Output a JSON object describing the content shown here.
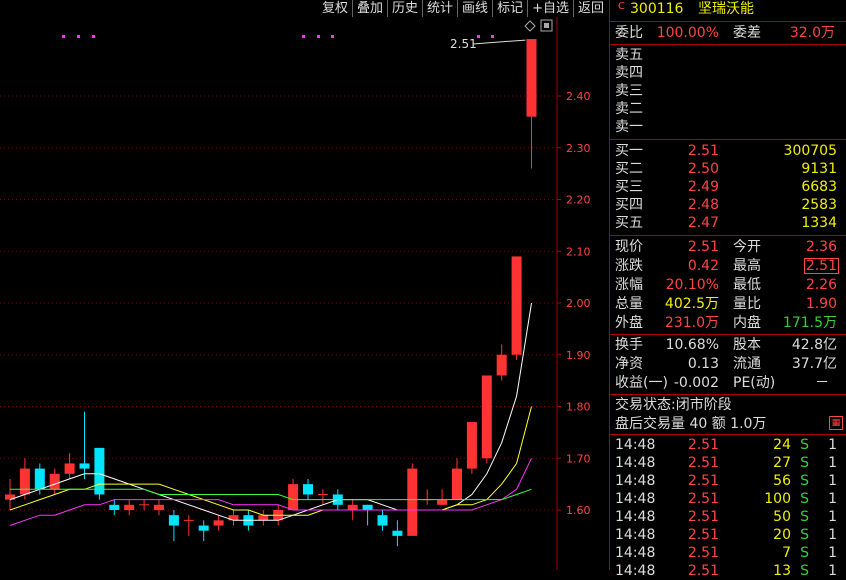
{
  "toolbar": {
    "items": [
      "复权",
      "叠加",
      "历史",
      "统计",
      "画线",
      "标记",
      "+自选",
      "返回"
    ]
  },
  "chart": {
    "y_ticks": [
      "2.40",
      "2.30",
      "2.20",
      "2.10",
      "2.00",
      "1.90",
      "1.80",
      "1.70",
      "1.60"
    ],
    "last_price_label": "2.51",
    "up_color": "#ff3333",
    "down_color": "#00e5ff",
    "ma_colors": [
      "#ffffff",
      "#ffff33",
      "#ff33ff",
      "#33ff33"
    ]
  },
  "chart_data": {
    "type": "candlestick",
    "ylim": [
      1.53,
      2.56
    ],
    "candles": [
      {
        "o": 1.62,
        "c": 1.63,
        "h": 1.66,
        "l": 1.6
      },
      {
        "o": 1.63,
        "c": 1.68,
        "h": 1.7,
        "l": 1.62
      },
      {
        "o": 1.68,
        "c": 1.64,
        "h": 1.69,
        "l": 1.63
      },
      {
        "o": 1.64,
        "c": 1.67,
        "h": 1.68,
        "l": 1.63
      },
      {
        "o": 1.67,
        "c": 1.69,
        "h": 1.71,
        "l": 1.66
      },
      {
        "o": 1.69,
        "c": 1.68,
        "h": 1.79,
        "l": 1.66
      },
      {
        "o": 1.72,
        "c": 1.63,
        "h": 1.72,
        "l": 1.62
      },
      {
        "o": 1.61,
        "c": 1.6,
        "h": 1.62,
        "l": 1.59
      },
      {
        "o": 1.6,
        "c": 1.61,
        "h": 1.62,
        "l": 1.59
      },
      {
        "o": 1.61,
        "c": 1.61,
        "h": 1.62,
        "l": 1.6
      },
      {
        "o": 1.6,
        "c": 1.61,
        "h": 1.62,
        "l": 1.59
      },
      {
        "o": 1.59,
        "c": 1.57,
        "h": 1.6,
        "l": 1.54
      },
      {
        "o": 1.58,
        "c": 1.58,
        "h": 1.59,
        "l": 1.55
      },
      {
        "o": 1.57,
        "c": 1.56,
        "h": 1.58,
        "l": 1.54
      },
      {
        "o": 1.57,
        "c": 1.58,
        "h": 1.59,
        "l": 1.56
      },
      {
        "o": 1.58,
        "c": 1.59,
        "h": 1.6,
        "l": 1.57
      },
      {
        "o": 1.59,
        "c": 1.57,
        "h": 1.6,
        "l": 1.56
      },
      {
        "o": 1.58,
        "c": 1.59,
        "h": 1.6,
        "l": 1.57
      },
      {
        "o": 1.58,
        "c": 1.6,
        "h": 1.61,
        "l": 1.57
      },
      {
        "o": 1.6,
        "c": 1.65,
        "h": 1.66,
        "l": 1.6
      },
      {
        "o": 1.65,
        "c": 1.63,
        "h": 1.66,
        "l": 1.62
      },
      {
        "o": 1.63,
        "c": 1.63,
        "h": 1.64,
        "l": 1.61
      },
      {
        "o": 1.63,
        "c": 1.61,
        "h": 1.64,
        "l": 1.6
      },
      {
        "o": 1.6,
        "c": 1.61,
        "h": 1.62,
        "l": 1.58
      },
      {
        "o": 1.61,
        "c": 1.6,
        "h": 1.61,
        "l": 1.57
      },
      {
        "o": 1.59,
        "c": 1.57,
        "h": 1.6,
        "l": 1.56
      },
      {
        "o": 1.56,
        "c": 1.55,
        "h": 1.58,
        "l": 1.53
      },
      {
        "o": 1.55,
        "c": 1.68,
        "h": 1.69,
        "l": 1.55
      },
      {
        "o": 1.62,
        "c": 1.62,
        "h": 1.64,
        "l": 1.61
      },
      {
        "o": 1.61,
        "c": 1.62,
        "h": 1.64,
        "l": 1.61
      },
      {
        "o": 1.62,
        "c": 1.68,
        "h": 1.7,
        "l": 1.62
      },
      {
        "o": 1.68,
        "c": 1.77,
        "h": 1.77,
        "l": 1.67
      },
      {
        "o": 1.7,
        "c": 1.86,
        "h": 1.86,
        "l": 1.69
      },
      {
        "o": 1.86,
        "c": 1.9,
        "h": 1.92,
        "l": 1.85
      },
      {
        "o": 1.9,
        "c": 2.09,
        "h": 2.09,
        "l": 1.89
      },
      {
        "o": 2.36,
        "c": 2.51,
        "h": 2.51,
        "l": 2.26
      }
    ],
    "ma5": [
      1.62,
      1.63,
      1.64,
      1.65,
      1.66,
      1.67,
      1.67,
      1.66,
      1.65,
      1.64,
      1.63,
      1.62,
      1.61,
      1.6,
      1.59,
      1.58,
      1.58,
      1.58,
      1.58,
      1.59,
      1.6,
      1.61,
      1.62,
      1.62,
      1.62,
      1.61,
      1.6,
      1.6,
      1.6,
      1.6,
      1.61,
      1.63,
      1.67,
      1.73,
      1.82,
      2.0
    ],
    "ma10": [
      1.6,
      1.61,
      1.62,
      1.63,
      1.64,
      1.64,
      1.65,
      1.65,
      1.65,
      1.65,
      1.65,
      1.64,
      1.63,
      1.62,
      1.61,
      1.6,
      1.6,
      1.59,
      1.59,
      1.59,
      1.59,
      1.6,
      1.6,
      1.6,
      1.6,
      1.6,
      1.6,
      1.6,
      1.6,
      1.6,
      1.61,
      1.61,
      1.62,
      1.65,
      1.69,
      1.8
    ],
    "ma20": [
      1.57,
      1.58,
      1.59,
      1.59,
      1.6,
      1.61,
      1.61,
      1.62,
      1.62,
      1.62,
      1.62,
      1.62,
      1.62,
      1.62,
      1.62,
      1.61,
      1.61,
      1.61,
      1.61,
      1.6,
      1.6,
      1.6,
      1.6,
      1.6,
      1.6,
      1.6,
      1.6,
      1.6,
      1.6,
      1.6,
      1.6,
      1.6,
      1.61,
      1.62,
      1.64,
      1.7
    ],
    "ma60": [
      1.64,
      1.64,
      1.64,
      1.64,
      1.64,
      1.64,
      1.64,
      1.64,
      1.64,
      1.64,
      1.63,
      1.63,
      1.63,
      1.63,
      1.63,
      1.63,
      1.63,
      1.63,
      1.63,
      1.62,
      1.62,
      1.62,
      1.62,
      1.62,
      1.62,
      1.62,
      1.62,
      1.62,
      1.62,
      1.62,
      1.62,
      1.62,
      1.62,
      1.62,
      1.63,
      1.64
    ]
  },
  "quote": {
    "badge": "C",
    "code": "300116",
    "name": "坚瑞沃能",
    "weibi_label": "委比",
    "weibi": "100.00%",
    "weicha_label": "委差",
    "weicha": "32.0万",
    "sell": [
      {
        "label": "卖五"
      },
      {
        "label": "卖四"
      },
      {
        "label": "卖三"
      },
      {
        "label": "卖二"
      },
      {
        "label": "卖一"
      }
    ],
    "buy": [
      {
        "label": "买一",
        "price": "2.51",
        "vol": "300705"
      },
      {
        "label": "买二",
        "price": "2.50",
        "vol": "9131"
      },
      {
        "label": "买三",
        "price": "2.49",
        "vol": "6683"
      },
      {
        "label": "买四",
        "price": "2.48",
        "vol": "2583"
      },
      {
        "label": "买五",
        "price": "2.47",
        "vol": "1334"
      }
    ],
    "stats": [
      {
        "l1": "现价",
        "v1": "2.51",
        "l2": "今开",
        "v2": "2.36"
      },
      {
        "l1": "涨跌",
        "v1": "0.42",
        "l2": "最高",
        "v2": "2.51"
      },
      {
        "l1": "涨幅",
        "v1": "20.10%",
        "l2": "最低",
        "v2": "2.26"
      },
      {
        "l1": "总量",
        "v1": "402.5万",
        "l2": "量比",
        "v2": "1.90"
      },
      {
        "l1": "外盘",
        "v1": "231.0万",
        "l2": "内盘",
        "v2": "171.5万"
      }
    ],
    "fund": [
      {
        "l1": "换手",
        "v1": "10.68%",
        "l2": "股本",
        "v2": "42.8亿"
      },
      {
        "l1": "净资",
        "v1": "0.13",
        "l2": "流通",
        "v2": "37.7亿"
      },
      {
        "l1": "收益(一)",
        "v1": "-0.002",
        "l2": "PE(动)",
        "v2": "－"
      }
    ],
    "status_text": "交易状态:闭市阶段",
    "after_hours_text": "盘后交易量 40 额 1.0万",
    "ticks": [
      {
        "t": "14:48",
        "p": "2.51",
        "v": "24",
        "s": "S",
        "n": "1"
      },
      {
        "t": "14:48",
        "p": "2.51",
        "v": "27",
        "s": "S",
        "n": "1"
      },
      {
        "t": "14:48",
        "p": "2.51",
        "v": "56",
        "s": "S",
        "n": "1"
      },
      {
        "t": "14:48",
        "p": "2.51",
        "v": "100",
        "s": "S",
        "n": "1"
      },
      {
        "t": "14:48",
        "p": "2.51",
        "v": "50",
        "s": "S",
        "n": "1"
      },
      {
        "t": "14:48",
        "p": "2.51",
        "v": "20",
        "s": "S",
        "n": "1"
      },
      {
        "t": "14:48",
        "p": "2.51",
        "v": "7",
        "s": "S",
        "n": "1"
      },
      {
        "t": "14:48",
        "p": "2.51",
        "v": "13",
        "s": "S",
        "n": "1"
      }
    ]
  }
}
